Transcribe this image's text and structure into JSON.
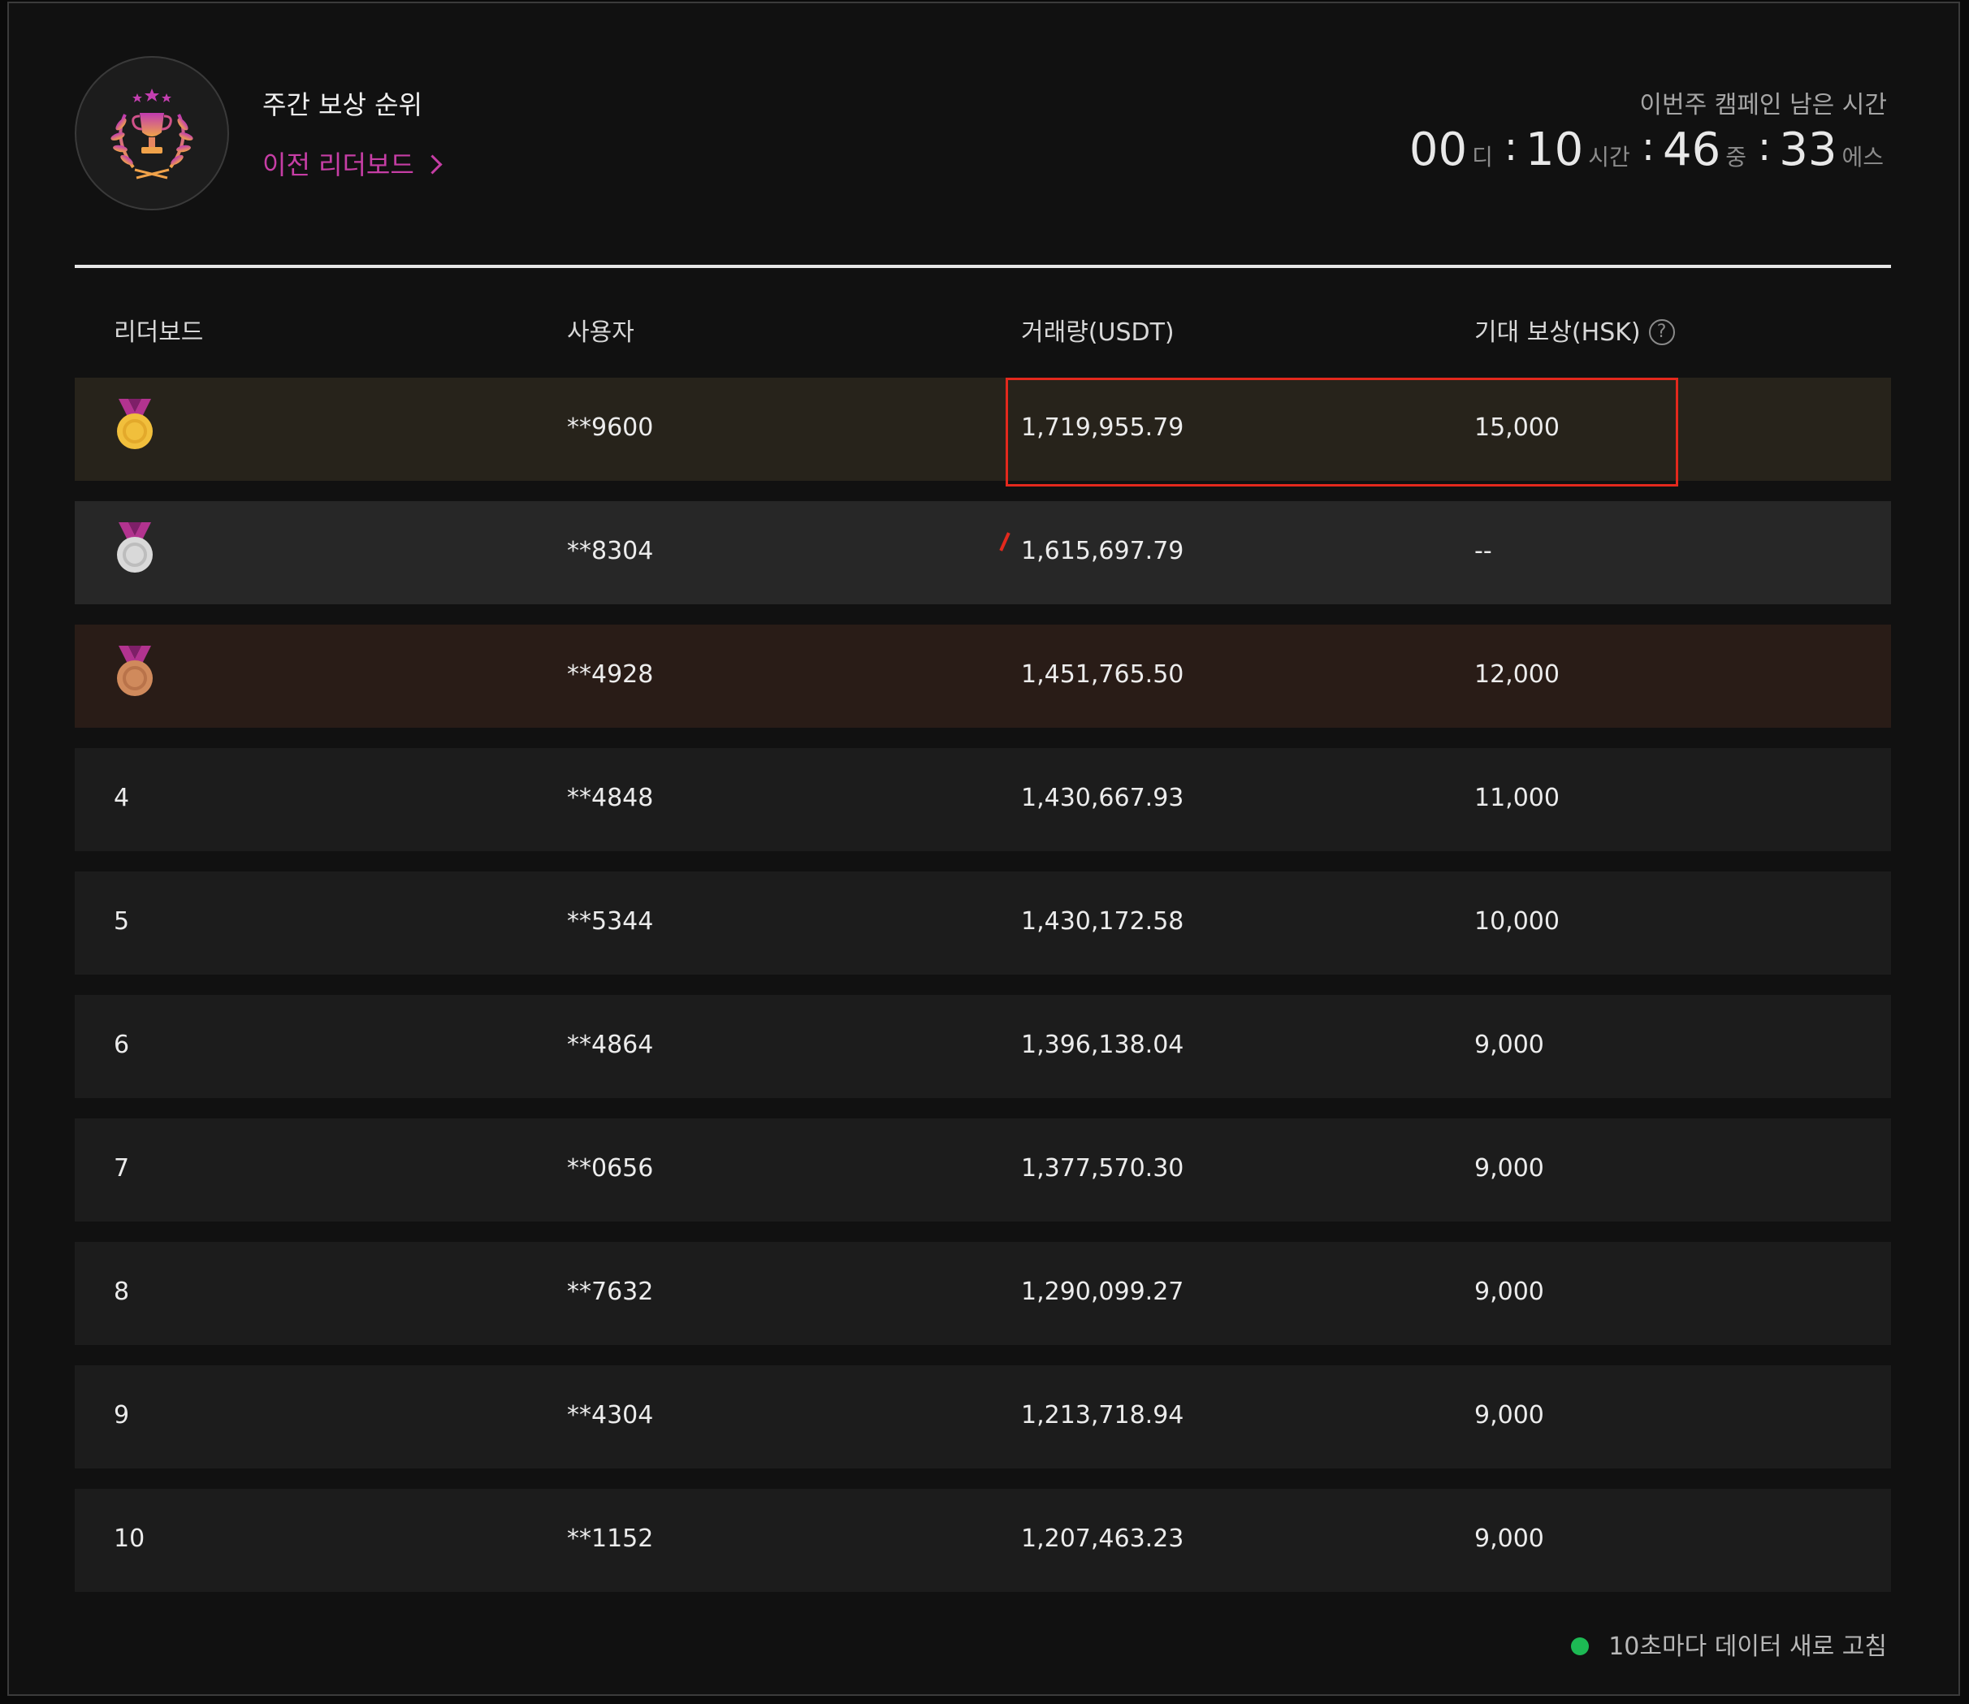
{
  "header": {
    "title": "주간 보상 순위",
    "prev_leaderboard": "이전 리더보드",
    "countdown_label": "이번주 캠페인 남은 시간",
    "countdown": {
      "days": "00",
      "days_unit": "디",
      "hours": "10",
      "hours_unit": "시간",
      "minutes": "46",
      "minutes_unit": "중",
      "seconds": "33",
      "seconds_unit": "에스",
      "separator": ":"
    }
  },
  "colors": {
    "accent_pink": "#c63ea5",
    "highlight_red": "#e3291d",
    "refresh_green": "#1db954",
    "gold_row": "#27231b",
    "silver_row": "#272727",
    "bronze_row": "#291c17"
  },
  "table": {
    "headers": {
      "rank": "리더보드",
      "user": "사용자",
      "volume": "거래량(USDT)",
      "reward": "기대 보상(HSK)",
      "help": "?"
    },
    "rows": [
      {
        "rank": "",
        "medal": "gold-medal-icon",
        "user": "**9600",
        "volume": "1,719,955.79",
        "reward": "15,000"
      },
      {
        "rank": "",
        "medal": "silver-medal-icon",
        "user": "**8304",
        "volume": "1,615,697.79",
        "reward": "--"
      },
      {
        "rank": "",
        "medal": "bronze-medal-icon",
        "user": "**4928",
        "volume": "1,451,765.50",
        "reward": "12,000"
      },
      {
        "rank": "4",
        "user": "**4848",
        "volume": "1,430,667.93",
        "reward": "11,000"
      },
      {
        "rank": "5",
        "user": "**5344",
        "volume": "1,430,172.58",
        "reward": "10,000"
      },
      {
        "rank": "6",
        "user": "**4864",
        "volume": "1,396,138.04",
        "reward": "9,000"
      },
      {
        "rank": "7",
        "user": "**0656",
        "volume": "1,377,570.30",
        "reward": "9,000"
      },
      {
        "rank": "8",
        "user": "**7632",
        "volume": "1,290,099.27",
        "reward": "9,000"
      },
      {
        "rank": "9",
        "user": "**4304",
        "volume": "1,213,718.94",
        "reward": "9,000"
      },
      {
        "rank": "10",
        "user": "**1152",
        "volume": "1,207,463.23",
        "reward": "9,000"
      }
    ]
  },
  "footer": {
    "refresh_text": "10초마다 데이터 새로 고침"
  }
}
